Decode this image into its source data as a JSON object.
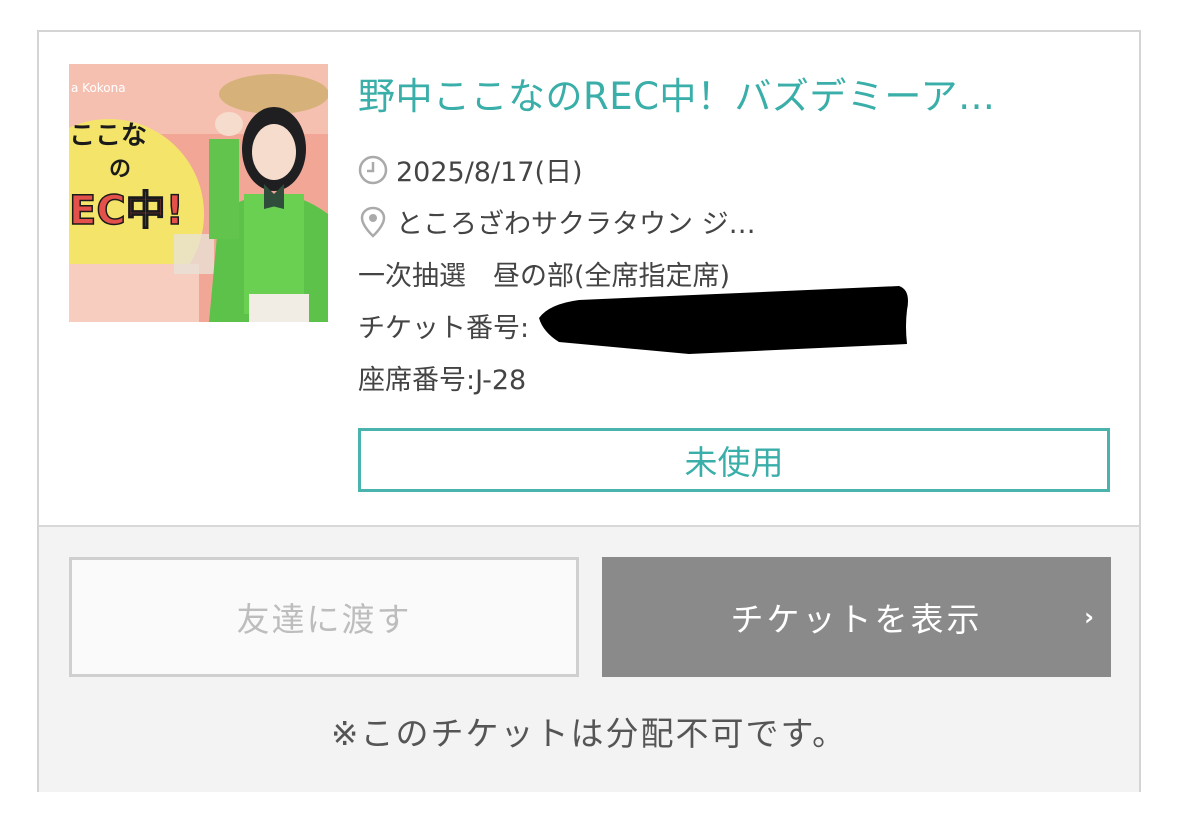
{
  "event": {
    "title": "野中ここなのREC中！バズデミーア…",
    "date": "2025/8/17(日)",
    "venue": "ところざわサクラタウン ジ…",
    "lottery": "一次抽選　昼の部(全席指定席)",
    "ticket_number_label": "チケット番号:",
    "seat": "座席番号:J-28",
    "status": "未使用",
    "thumbnail_text": {
      "top": "a Kokona",
      "line1": "ここな",
      "line2": "の",
      "line3": "EC中!"
    }
  },
  "actions": {
    "gift_label": "友達に渡す",
    "show_label": "チケットを表示",
    "chevron": "›",
    "note": "※このチケットは分配不可です。"
  },
  "colors": {
    "accent": "#3aaea8",
    "button_gray": "#8a8a8a",
    "panel_bg": "#f3f3f3"
  }
}
